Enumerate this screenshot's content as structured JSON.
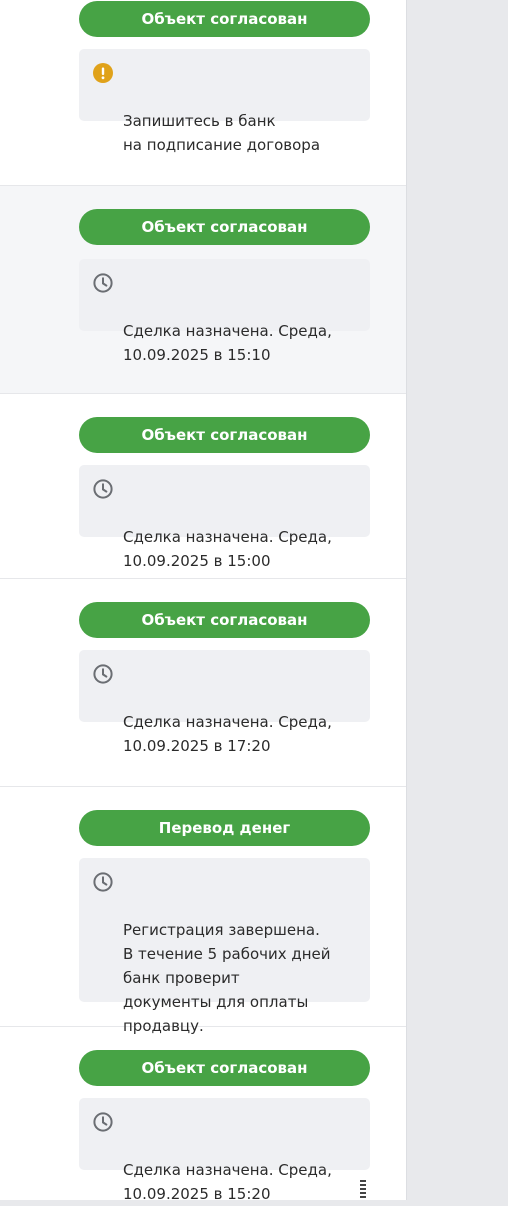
{
  "rows": [
    {
      "status": "Объект согласован",
      "icon": "warning-icon",
      "message": "Запишитесь в банк\nна подписание договора"
    },
    {
      "status": "Объект согласован",
      "icon": "clock-icon",
      "message": "Сделка назначена. Среда,\n10.09.2025 в 15:10"
    },
    {
      "status": "Объект согласован",
      "icon": "clock-icon",
      "message": "Сделка назначена. Среда,\n10.09.2025 в 15:00"
    },
    {
      "status": "Объект согласован",
      "icon": "clock-icon",
      "message": "Сделка назначена. Среда,\n10.09.2025 в 17:20"
    },
    {
      "status": "Перевод денег",
      "icon": "clock-icon",
      "message": "Регистрация завершена.\nВ течение 5 рабочих дней\nбанк проверит\nдокументы для оплаты\nпродавцу."
    },
    {
      "status": "Объект согласован",
      "icon": "clock-icon",
      "message": "Сделка назначена. Среда,\n10.09.2025 в 15:20"
    }
  ],
  "colors": {
    "status_green": "#47a345",
    "warning_yellow": "#e0a21a",
    "clock_gray": "#6b6e73",
    "box_bg": "#eff0f3"
  }
}
